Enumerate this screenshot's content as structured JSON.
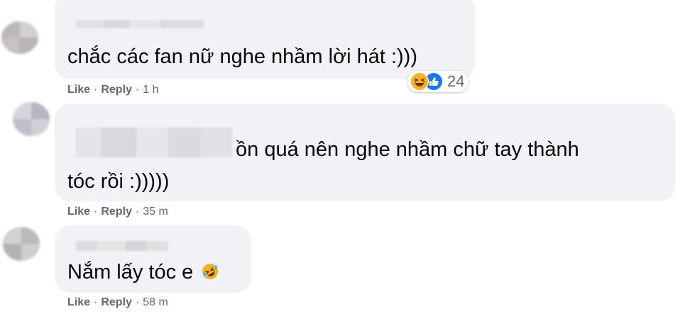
{
  "comments": [
    {
      "text_lines": [
        "chắc các fan nữ nghe nhầm lời hát :)))"
      ],
      "actions": {
        "like": "Like",
        "reply": "Reply",
        "separator": "·",
        "time": "1 h"
      },
      "reactions": {
        "icons": [
          "haha-icon",
          "like-icon"
        ],
        "count": "24"
      }
    },
    {
      "text_lines": [
        "ồn quá nên nghe nhầm chữ tay thành",
        "tóc rồi :)))))"
      ],
      "actions": {
        "like": "Like",
        "reply": "Reply",
        "separator": "·",
        "time": "35 m"
      }
    },
    {
      "text_lines": [
        "Nắm lấy tóc e"
      ],
      "emoji": "rofl-emoji",
      "actions": {
        "like": "Like",
        "reply": "Reply",
        "separator": "·",
        "time": "58 m"
      }
    }
  ],
  "colors": {
    "bubble": "#f0f2f5",
    "text": "#050505",
    "meta": "#65676b",
    "like_blue": "#1877f2",
    "haha_yellow": "#f7b125"
  }
}
